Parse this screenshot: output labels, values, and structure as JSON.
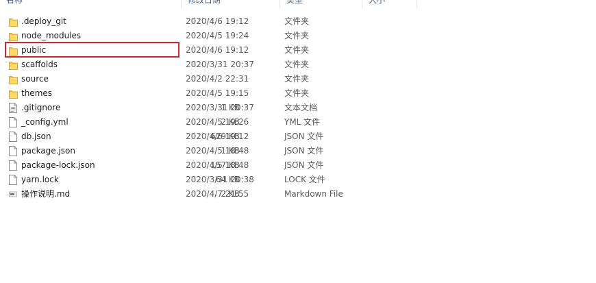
{
  "columns": {
    "name": "名称",
    "date": "修改日期",
    "type": "类型",
    "size": "大小"
  },
  "files": [
    {
      "name": ".deploy_git",
      "date": "2020/4/6 19:12",
      "type": "文件夹",
      "size": "",
      "icon": "folder-icon"
    },
    {
      "name": "node_modules",
      "date": "2020/4/5 19:24",
      "type": "文件夹",
      "size": "",
      "icon": "folder-icon"
    },
    {
      "name": "public",
      "date": "2020/4/6 19:12",
      "type": "文件夹",
      "size": "",
      "icon": "folder-icon",
      "highlighted": true
    },
    {
      "name": "scaffolds",
      "date": "2020/3/31 20:37",
      "type": "文件夹",
      "size": "",
      "icon": "folder-icon"
    },
    {
      "name": "source",
      "date": "2020/4/2 22:31",
      "type": "文件夹",
      "size": "",
      "icon": "folder-icon"
    },
    {
      "name": "themes",
      "date": "2020/4/5 19:15",
      "type": "文件夹",
      "size": "",
      "icon": "folder-icon"
    },
    {
      "name": ".gitignore",
      "date": "2020/3/31 20:37",
      "type": "文本文档",
      "size": "1 KB",
      "icon": "text-file-icon"
    },
    {
      "name": "_config.yml",
      "date": "2020/4/5 19:26",
      "type": "YML 文件",
      "size": "2 KB",
      "icon": "file-icon"
    },
    {
      "name": "db.json",
      "date": "2020/4/6 19:12",
      "type": "JSON 文件",
      "size": "629 KB",
      "icon": "file-icon"
    },
    {
      "name": "package.json",
      "date": "2020/4/5 18:48",
      "type": "JSON 文件",
      "size": "1 KB",
      "icon": "file-icon"
    },
    {
      "name": "package-lock.json",
      "date": "2020/4/5 18:48",
      "type": "JSON 文件",
      "size": "157 KB",
      "icon": "file-icon"
    },
    {
      "name": "yarn.lock",
      "date": "2020/3/31 20:38",
      "type": "LOCK 文件",
      "size": "64 KB",
      "icon": "file-icon"
    },
    {
      "name": "操作说明.md",
      "date": "2020/4/7 21:55",
      "type": "Markdown File",
      "size": "2 KB",
      "icon": "markdown-file-icon"
    }
  ],
  "colors": {
    "folder": "#f6c94a",
    "highlight": "#d0262d"
  }
}
